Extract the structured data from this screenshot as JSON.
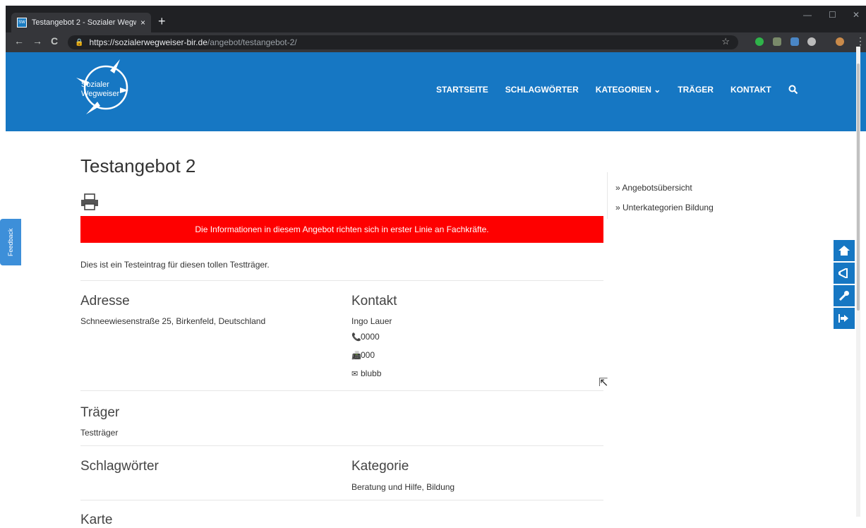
{
  "browser": {
    "tab_title": "Testangebot 2 - Sozialer Wegweiser",
    "tab_close": "×",
    "new_tab": "+",
    "window_min": "—",
    "window_max": "☐",
    "window_close": "✕",
    "nav_back": "←",
    "nav_forward": "→",
    "nav_reload": "C",
    "url_host": "https://sozialerwegweiser-bir.de",
    "url_path": "/angebot/testangebot-2/",
    "bookmark": "☆"
  },
  "site": {
    "logo_line1": "Sozialer",
    "logo_line2": "Wegweiser",
    "nav": [
      {
        "label": "STARTSEITE"
      },
      {
        "label": "SCHLAGWÖRTER"
      },
      {
        "label": "KATEGORIEN ⌄"
      },
      {
        "label": "TRÄGER"
      },
      {
        "label": "KONTAKT"
      }
    ],
    "brand_color": "#1677c3"
  },
  "feedback": "Feedback",
  "page": {
    "title": "Testangebot 2",
    "alert": "Die Informationen in diesem Angebot richten sich in erster Linie an Fachkräfte.",
    "description": "Dies ist ein Testeintrag für diesen tollen Testträger.",
    "address_heading": "Adresse",
    "address": "Schneewiesenstraße 25, Birkenfeld, Deutschland",
    "contact_heading": "Kontakt",
    "contact_name": "Ingo Lauer",
    "phone": "0000",
    "fax": "000",
    "email": "blubb",
    "traeger_heading": "Träger",
    "traeger": "Testträger",
    "schlagwoerter_heading": "Schlagwörter",
    "kategorie_heading": "Kategorie",
    "kategorie": "Beratung und Hilfe, Bildung",
    "karte_heading": "Karte"
  },
  "sidebar": {
    "links": [
      {
        "label": "» Angebotsübersicht"
      },
      {
        "label": "» Unterkategorien Bildung"
      }
    ]
  }
}
